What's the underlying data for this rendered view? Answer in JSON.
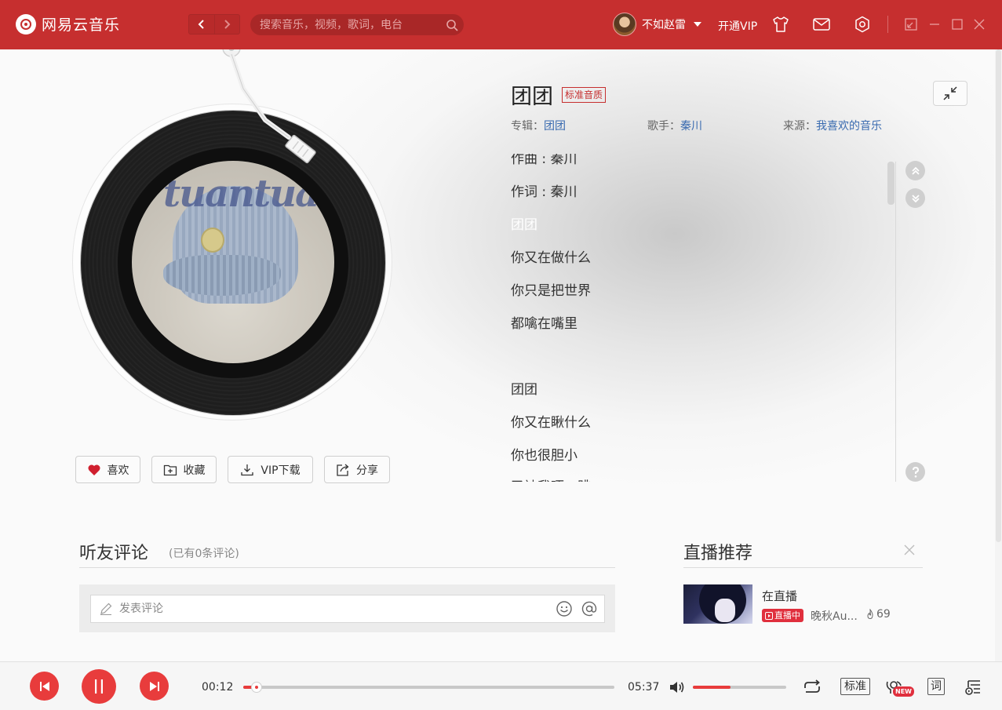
{
  "app": {
    "name": "网易云音乐"
  },
  "search": {
    "placeholder": "搜索音乐，视频，歌词，电台"
  },
  "user": {
    "name": "不如赵雷",
    "vip_label": "开通VIP"
  },
  "colors": {
    "brand": "#c62f2f",
    "accent": "#e83c3c",
    "link": "#3a6bb0"
  },
  "song": {
    "title": "团团",
    "quality_tag": "标准音质",
    "album_label": "专辑：",
    "album": "团团",
    "artist_label": "歌手：",
    "artist": "秦川",
    "source_label": "来源：",
    "source": "我喜欢的音乐",
    "cover_text": "tuantuan"
  },
  "lyrics": [
    {
      "text": "作曲 : 秦川",
      "active": false
    },
    {
      "text": "作词 : 秦川",
      "active": false
    },
    {
      "text": "团团",
      "active": true
    },
    {
      "text": "你又在做什么",
      "active": false
    },
    {
      "text": "你只是把世界",
      "active": false
    },
    {
      "text": "都噙在嘴里",
      "active": false
    },
    {
      "text": "",
      "active": false
    },
    {
      "text": "团团",
      "active": false
    },
    {
      "text": "你又在瞅什么",
      "active": false
    },
    {
      "text": "你也很胆小",
      "active": false
    },
    {
      "text": "又被我吓一跳",
      "active": false
    }
  ],
  "actions": {
    "like": "喜欢",
    "collect": "收藏",
    "download": "VIP下载",
    "share": "分享"
  },
  "comments": {
    "title": "听友评论",
    "count_text": "(已有0条评论)",
    "input_placeholder": "发表评论"
  },
  "live": {
    "title": "直播推荐",
    "item": {
      "name": "在直播",
      "badge": "直播中",
      "anchor": "晚秋Au...",
      "hot": "69"
    }
  },
  "player": {
    "current_time": "00:12",
    "total_time": "05:37",
    "progress_fraction": 0.036,
    "volume_fraction": 0.4,
    "quality_label": "标准",
    "lyric_label": "词",
    "new_badge": "NEW"
  },
  "icons": {
    "logo": "netease-logo-icon",
    "back": "chevron-left-icon",
    "forward": "chevron-right-icon",
    "search": "search-icon",
    "skin": "tshirt-icon",
    "mail": "mail-icon",
    "settings": "gear-icon",
    "mini": "mini-mode-icon",
    "minimize": "minimize-icon",
    "maximize": "maximize-icon",
    "close": "close-icon",
    "heart": "heart-icon",
    "collect": "folder-plus-icon",
    "download": "download-icon",
    "share": "share-icon",
    "shrink": "shrink-icon",
    "scroll_up": "double-chevron-up-icon",
    "scroll_down": "double-chevron-down-icon",
    "help": "question-icon",
    "pen": "pen-icon",
    "emoji": "smile-icon",
    "at": "at-icon",
    "prev": "previous-icon",
    "pause": "pause-icon",
    "next": "next-icon",
    "volume": "volume-icon",
    "repeat": "repeat-icon",
    "effect": "sound-effect-icon",
    "playlist": "playlist-icon"
  }
}
